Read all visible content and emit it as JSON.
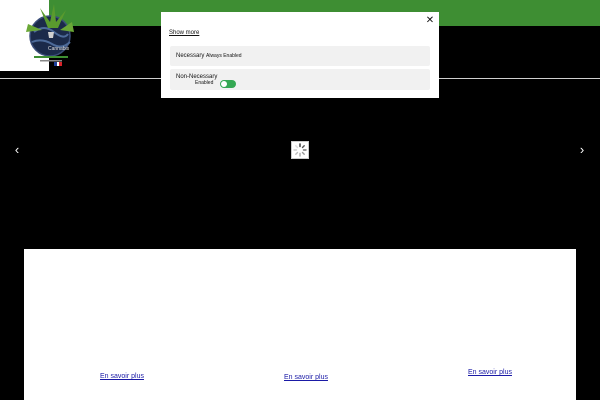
{
  "colors": {
    "topbar": "#3e8e33",
    "page_background": "#000000",
    "content_background": "#ffffff",
    "link": "#1a1aa6",
    "toggle_on": "#34a853"
  },
  "header": {
    "logo_icon": "cannabis-globe-logo-icon",
    "flag_icon": "france-flag-icon"
  },
  "carousel": {
    "prev_icon": "chevron-left-icon",
    "next_icon": "chevron-right-icon",
    "prev_glyph": "‹",
    "next_glyph": "›",
    "loader_icon": "loading-spinner-icon"
  },
  "content": {
    "links": [
      "En savoir plus",
      "En savoir plus",
      "En savoir plus"
    ]
  },
  "cookie_modal": {
    "close_icon": "close-icon",
    "close_glyph": "✕",
    "show_more": "Show more",
    "necessary": {
      "title": "Necessary",
      "status": "Always Enabled"
    },
    "non_necessary": {
      "title": "Non-Necessary",
      "toggle_label": "Enabled",
      "toggle_on": true
    }
  }
}
